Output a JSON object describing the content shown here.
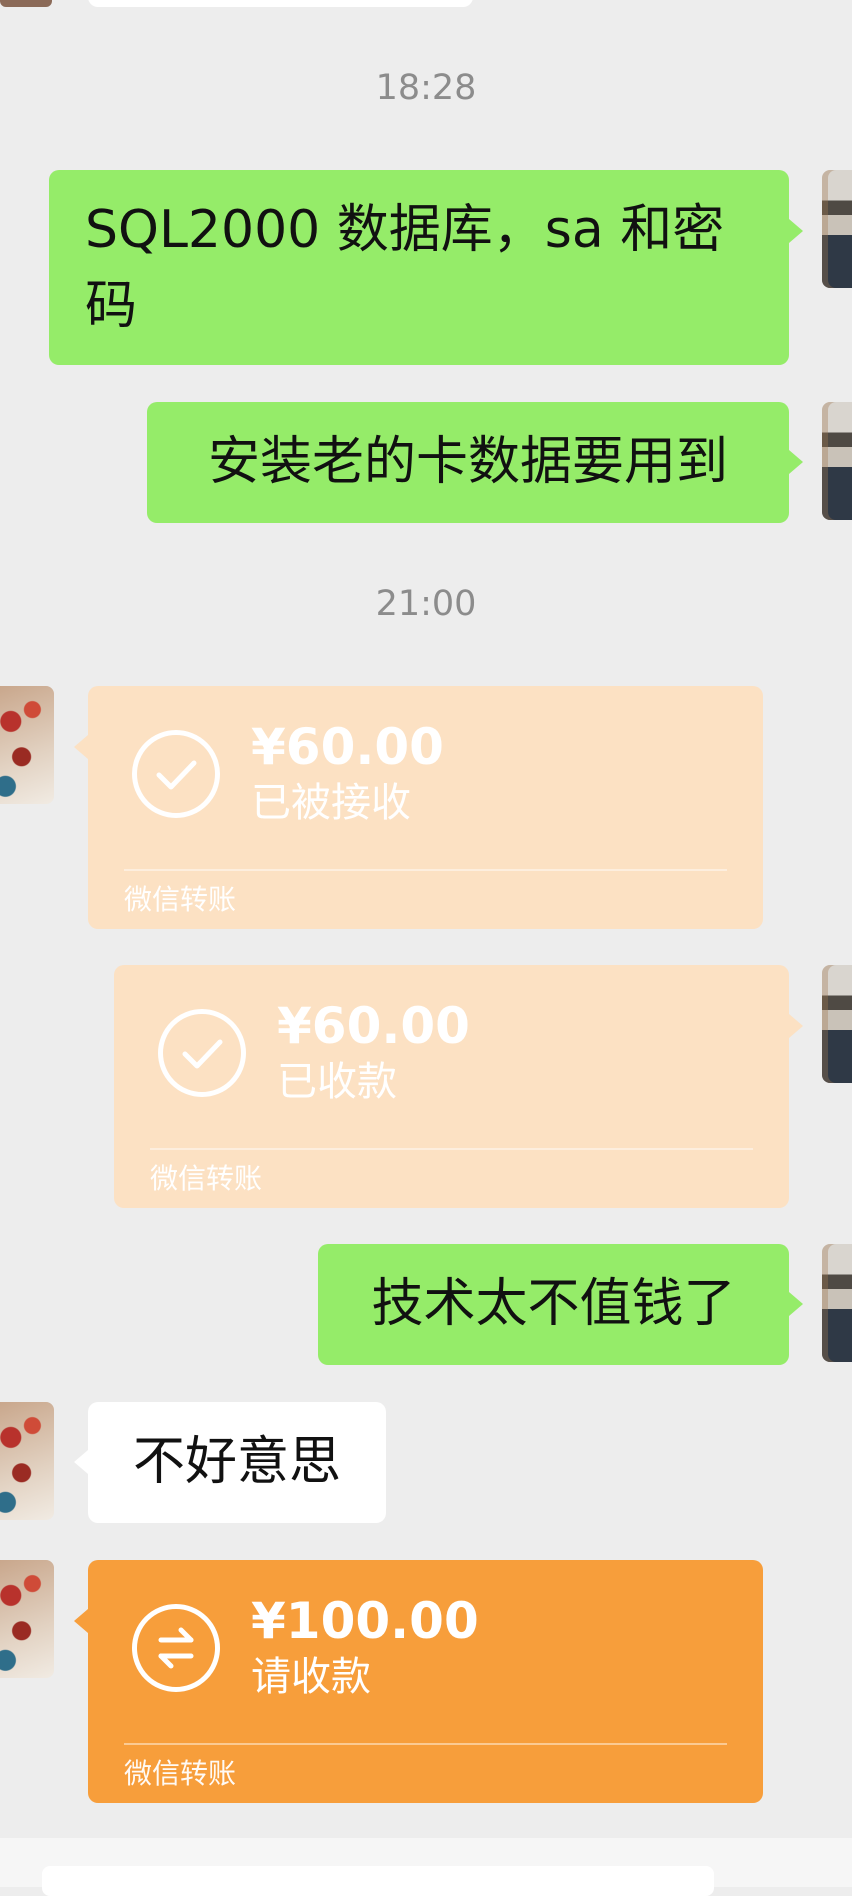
{
  "timestamps": [
    "18:28",
    "21:00"
  ],
  "messages": {
    "m1": "SQL2000 数据库，sa 和密码",
    "m2": "安装老的卡数据要用到",
    "m3": "技术太不值钱了",
    "m4": "不好意思"
  },
  "transfers": {
    "t1": {
      "amount": "¥60.00",
      "status": "已被接收",
      "label": "微信转账"
    },
    "t2": {
      "amount": "¥60.00",
      "status": "已收款",
      "label": "微信转账"
    },
    "t3": {
      "amount": "¥100.00",
      "status": "请收款",
      "label": "微信转账"
    }
  },
  "colors": {
    "background": "#ededed",
    "my_bubble": "#95ec69",
    "their_bubble": "#ffffff",
    "transfer_done": "#fce1c3",
    "transfer_pending": "#f79e3b"
  },
  "icons": {
    "transfer_done": "check-circle-icon",
    "transfer_pending": "exchange-arrows-icon"
  }
}
